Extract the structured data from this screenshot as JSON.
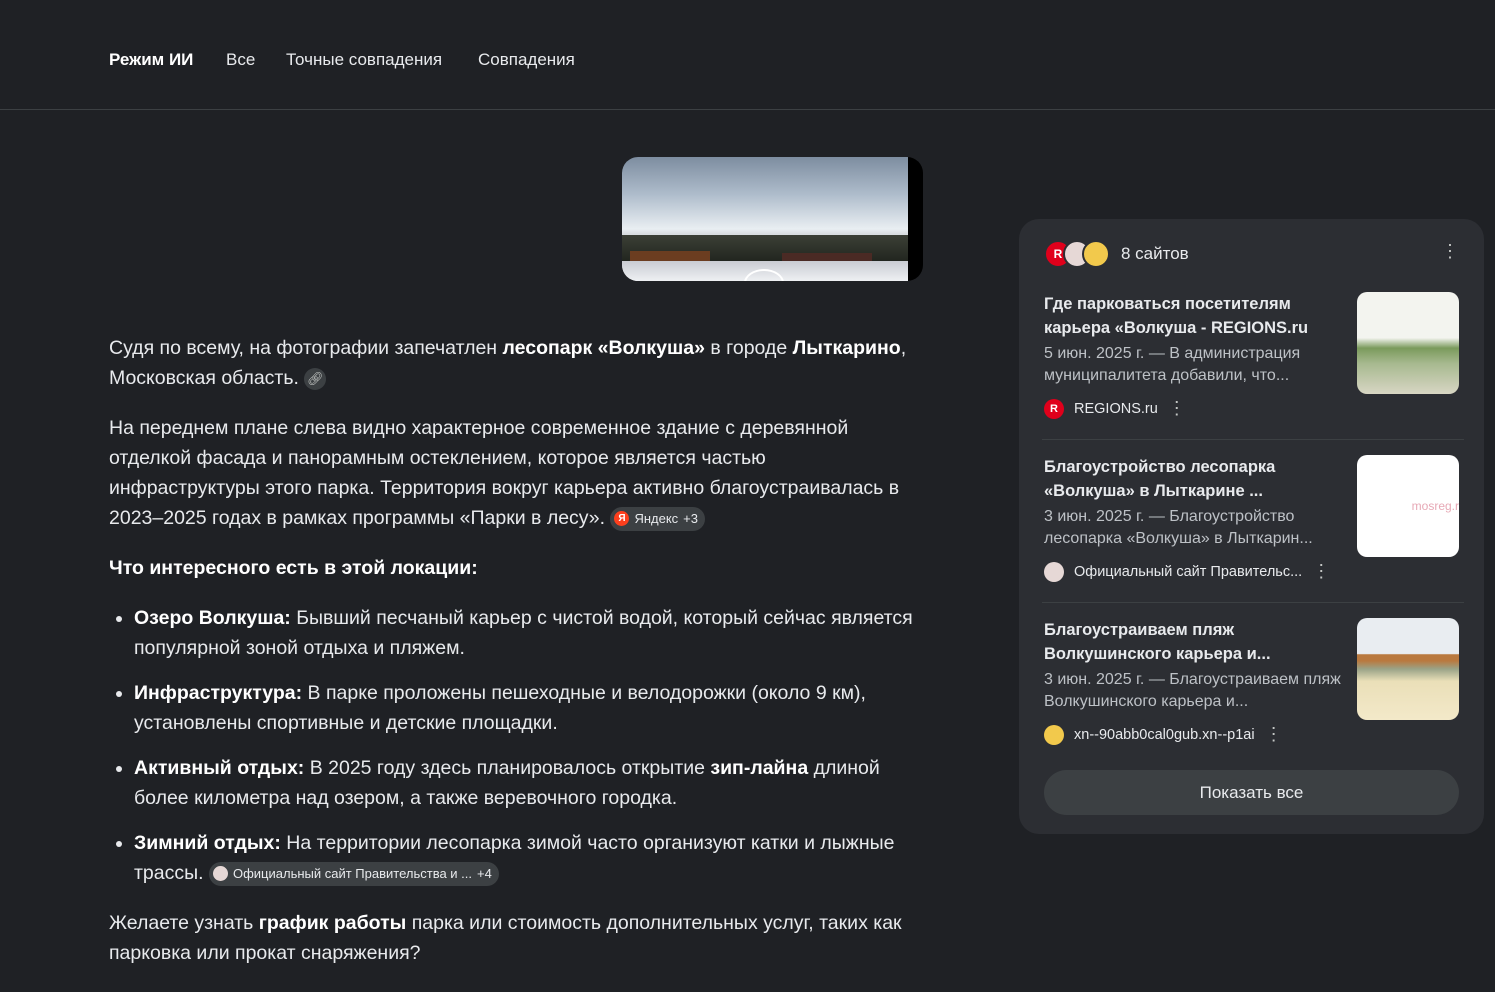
{
  "tabs": [
    "Режим ИИ",
    "Все",
    "Точные совпадения",
    "Совпадения"
  ],
  "answer": {
    "p1": {
      "pre": "Судя по всему, на фотографии запечатлен ",
      "bold1": "лесопарк «Волкуша»",
      "mid": " в городе ",
      "bold2": "Лыткарино",
      "post": ", Московская область."
    },
    "p2": {
      "text": "На переднем плане слева видно характерное современное здание с деревянной отделкой фасада и панорамным остеклением, которое является частью инфраструктуры этого парка. Территория вокруг карьера активно благоустраивалась в 2023–2025 годах в рамках программы «Парки в лесу».",
      "cite_label": "Яндекс",
      "cite_more": "+3"
    },
    "heading": "Что интересного есть в этой локации:",
    "bullets": [
      {
        "label": "Озеро Волкуша:",
        "text": " Бывший песчаный карьер с чистой водой, который сейчас является популярной зоной отдыха и пляжем."
      },
      {
        "label": "Инфраструктура:",
        "text": " В парке проложены пешеходные и велодорожки (около 9 км), установлены спортивные и детские площадки."
      },
      {
        "label": "Активный отдых:",
        "pre": " В 2025 году здесь планировалось открытие ",
        "bold": "зип-лайна",
        "post": " длиной более километра над озером, а также веревочного городка."
      },
      {
        "label": "Зимний отдых:",
        "text": " На территории лесопарка зимой часто организуют катки и лыжные трассы.",
        "cite_label": "Официальный сайт Правительства и ...",
        "cite_more": "+4"
      }
    ],
    "closing": {
      "pre": "Желаете узнать ",
      "bold": "график работы",
      "post": " парка или стоимость дополнительных услуг, таких как парковка или прокат снаряжения?"
    }
  },
  "sources": {
    "count_label": "8 сайтов",
    "items": [
      {
        "title": "Где парковаться посетителям карьера «Волкуша - REGIONS.ru",
        "snippet": "5 июн. 2025 г. — В администрация муниципалитета добавили, что...",
        "site": "REGIONS.ru",
        "icon": "regions-icon"
      },
      {
        "title": "Благоустройство лесопарка «Волкуша» в Лыткарине ...",
        "snippet": "3 июн. 2025 г. — Благоустройство лесопарка «Волкуша» в Лыткарин...",
        "site": "Официальный сайт Правительс...",
        "icon": "mosreg-icon",
        "thumb_text": "mosreg.r"
      },
      {
        "title": "Благоустраиваем пляж Волкушинского карьера и...",
        "snippet": "3 июн. 2025 г. — Благоустраиваем пляж Волкушинского карьера и...",
        "site": "xn--90abb0cal0gub.xn--p1ai",
        "icon": "city-crest-icon"
      }
    ],
    "show_all": "Показать все"
  },
  "colors": {
    "background": "#1f2125",
    "panel": "#2c2e33",
    "chip": "#3c4043",
    "regions_red": "#e0001b",
    "yandex_red": "#fc3f1d"
  }
}
